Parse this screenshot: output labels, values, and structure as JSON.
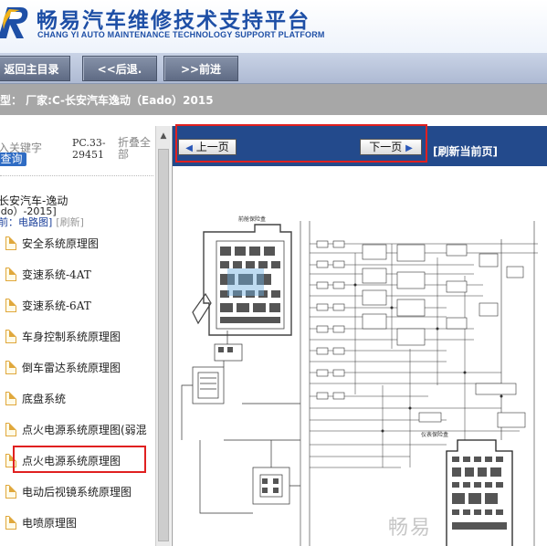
{
  "header": {
    "title": "畅易汽车维修技术支持平台",
    "subtitle": "CHANG YI AUTO MAINTENANCE TECHNOLOGY SUPPORT PLATFORM",
    "logo_icon": "cr-logo-icon",
    "brand_color": "#1e4fa6"
  },
  "nav": {
    "home": "返回主目录",
    "back": "<<后退.",
    "forward": ">>前进"
  },
  "vehicle": {
    "text": "型：  厂家:C-长安汽车逸动（Eado）2015"
  },
  "sidebar": {
    "keyword_placeholder": "入关键字",
    "query": "查询",
    "pc_code": "PC.33-29451",
    "collapse_all": "折叠全部",
    "model_name": "长安汽车-逸动",
    "model_year": "ado）-2015]",
    "current_label": "前：电路图]",
    "refresh": "[刷新]",
    "items": [
      {
        "label": "安全系统原理图"
      },
      {
        "label": "变速系统-4AT"
      },
      {
        "label": "变速系统-6AT"
      },
      {
        "label": "车身控制系统原理图"
      },
      {
        "label": "倒车雷达系统原理图"
      },
      {
        "label": "底盘系统"
      },
      {
        "label": "点火电源系统原理图(弱混"
      },
      {
        "label": "点火电源系统原理图"
      },
      {
        "label": "电动后视镜系统原理图"
      },
      {
        "label": "电喷原理图"
      }
    ],
    "selected_index": 7
  },
  "pager": {
    "prev": "上一页",
    "next": "下一页",
    "refresh_current": "[刷新当前页]"
  },
  "diagram": {
    "fuse_box_label": "前舱保险盒",
    "instrument_fuse_label": "仪表保险盒",
    "watermark": "畅易"
  },
  "colors": {
    "header_blue": "#1e4fa6",
    "pager_bar": "#234a8c",
    "highlight_red": "#e02020",
    "info_bar": "#a7a7a7"
  }
}
